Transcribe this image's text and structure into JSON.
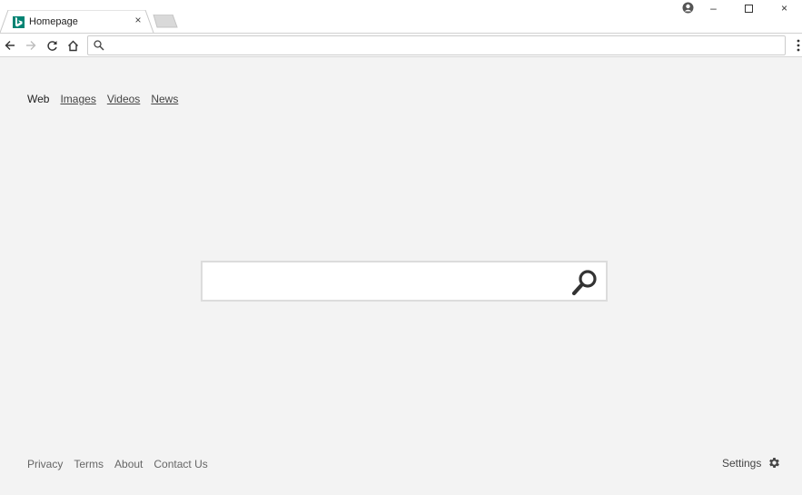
{
  "browser": {
    "tab": {
      "title": "Homepage",
      "close_glyph": "×"
    },
    "window_controls": {
      "minimize": "–",
      "maximize": "☐",
      "close": "×"
    },
    "omnibox": {
      "value": "",
      "placeholder": ""
    },
    "icons": {
      "favicon": "bing-logo-icon",
      "profile": "profile-icon",
      "back": "back-arrow-icon",
      "forward": "forward-arrow-icon",
      "reload": "reload-icon",
      "home": "home-icon",
      "omnibox_search": "search-icon",
      "menu": "more-vert-icon"
    },
    "colors": {
      "favicon": "#008373"
    }
  },
  "page": {
    "scopes": [
      {
        "label": "Web",
        "active": true
      },
      {
        "label": "Images",
        "active": false
      },
      {
        "label": "Videos",
        "active": false
      },
      {
        "label": "News",
        "active": false
      }
    ],
    "search": {
      "value": "",
      "placeholder": "",
      "icon": "magnifier-icon"
    },
    "footer": {
      "links": [
        "Privacy",
        "Terms",
        "About",
        "Contact Us"
      ],
      "settings_label": "Settings",
      "settings_icon": "gear-icon"
    }
  }
}
